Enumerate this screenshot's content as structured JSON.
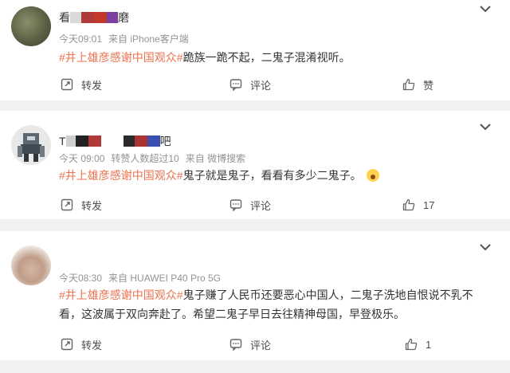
{
  "comments": [
    {
      "name_fragment": "看",
      "name_suffix": "磨",
      "time": "今天09:01",
      "source": "来自 iPhone客户端",
      "hashtag": "#井上雄彦感谢中国观众#",
      "text": "跪族一跪不起，二鬼子混淆视听。",
      "repost_label": "转发",
      "comment_label": "评论",
      "like_label": "赞"
    },
    {
      "name_fragment": "T",
      "name_suffix": "吧",
      "time": "今天 09:00",
      "extra": "转赞人数超过10",
      "source": "来自 微博搜索",
      "hashtag": "#井上雄彦感谢中国观众#",
      "text": "鬼子就是鬼子，看看有多少二鬼子。",
      "repost_label": "转发",
      "comment_label": "评论",
      "like_count": "17"
    },
    {
      "time": "今天08:30",
      "source": "来自 HUAWEI P40 Pro 5G",
      "hashtag": "#井上雄彦感谢中国观众#",
      "text": "鬼子赚了人民币还要恶心中国人，二鬼子洗地自恨说不乳不看，这波属于双向奔赴了。希望二鬼子早日去往精神母国，早登极乐。",
      "repost_label": "转发",
      "comment_label": "评论",
      "like_count": "1"
    }
  ],
  "colors": {
    "hashtag": "#eb7350",
    "meta": "#939393",
    "text": "#333333",
    "background": "#f2f2f2"
  },
  "icons": {
    "repost": "repost-icon",
    "comment": "comment-icon",
    "like": "thumbs-up-icon",
    "menu": "chevron-down-icon"
  }
}
